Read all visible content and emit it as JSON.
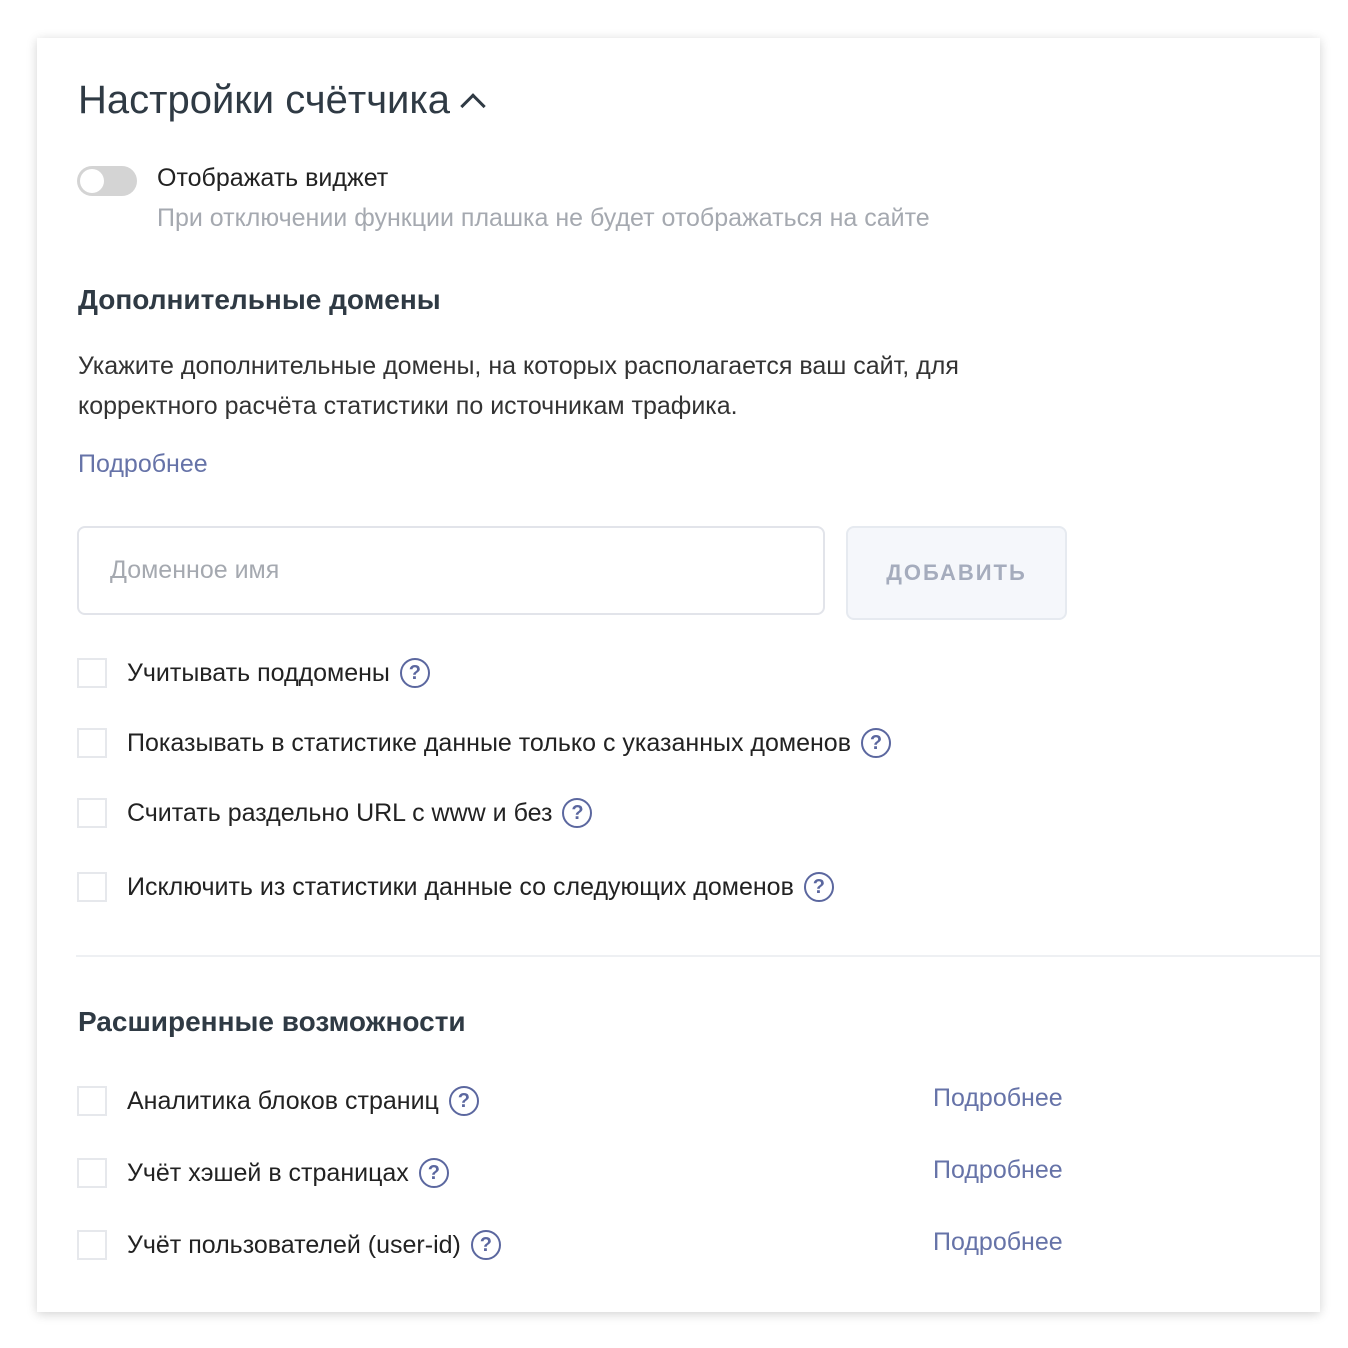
{
  "header": {
    "title": "Настройки счётчика"
  },
  "widget": {
    "label": "Отображать виджет",
    "hint": "При отключении функции плашка не будет отображаться на сайте",
    "enabled": false
  },
  "domains": {
    "title": "Дополнительные домены",
    "description": "Укажите дополнительные домены, на которых располагается ваш сайт, для корректного расчёта статистики по источникам трафика.",
    "more_link": "Подробнее",
    "input_placeholder": "Доменное имя",
    "add_button": "ДОБАВИТЬ",
    "options": [
      {
        "label": "Учитывать поддомены",
        "checked": false
      },
      {
        "label": "Показывать в статистике данные только с указанных доменов",
        "checked": false
      },
      {
        "label": "Считать раздельно URL с www и без",
        "checked": false
      },
      {
        "label": "Исключить из статистики данные со следующих доменов",
        "checked": false
      }
    ]
  },
  "advanced": {
    "title": "Расширенные возможности",
    "options": [
      {
        "label": "Аналитика блоков страниц",
        "more": "Подробнее",
        "checked": false
      },
      {
        "label": "Учёт хэшей в страницах",
        "more": "Подробнее",
        "checked": false
      },
      {
        "label": "Учёт пользователей (user-id)",
        "more": "Подробнее",
        "checked": false
      }
    ]
  },
  "help_glyph": "?"
}
